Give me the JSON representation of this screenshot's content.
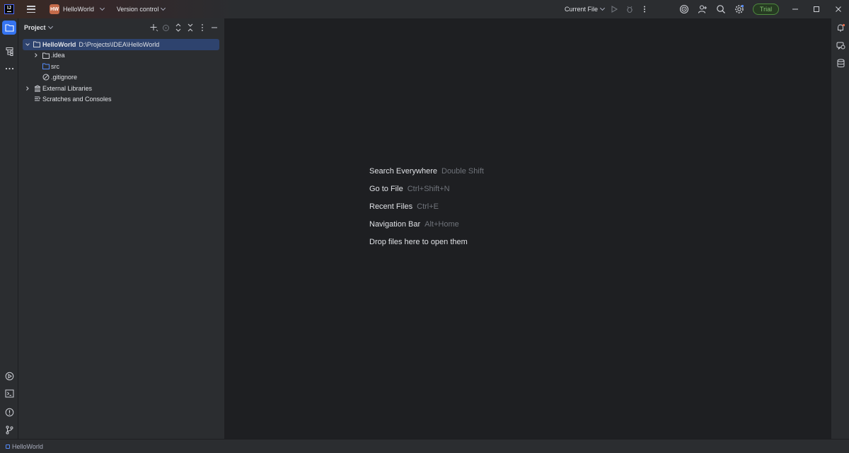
{
  "titlebar": {
    "project_badge": "HW",
    "project_name": "HelloWorld",
    "vcs_label": "Version control",
    "run_config": "Current File",
    "trial_label": "Trial"
  },
  "project_panel": {
    "title": "Project",
    "tree": [
      {
        "label": "HelloWorld",
        "path": "D:\\Projects\\IDEA\\HelloWorld"
      },
      {
        "label": ".idea"
      },
      {
        "label": "src"
      },
      {
        "label": ".gitignore"
      },
      {
        "label": "External Libraries"
      },
      {
        "label": "Scratches and Consoles"
      }
    ]
  },
  "editor": {
    "hints": [
      {
        "label": "Search Everywhere",
        "key": "Double Shift"
      },
      {
        "label": "Go to File",
        "key": "Ctrl+Shift+N"
      },
      {
        "label": "Recent Files",
        "key": "Ctrl+E"
      },
      {
        "label": "Navigation Bar",
        "key": "Alt+Home"
      },
      {
        "label": "Drop files here to open them",
        "key": ""
      }
    ]
  },
  "statusbar": {
    "breadcrumb": "HelloWorld"
  },
  "icons": {
    "left_strip": [
      "project-folder-icon",
      "structure-icon",
      "more-tools-icon",
      "run-icon",
      "terminal-icon",
      "problems-icon",
      "git-icon"
    ],
    "right_strip": [
      "notifications-icon",
      "ai-assistant-icon",
      "database-icon"
    ],
    "titlebar": [
      "app-logo-icon",
      "main-menu-icon",
      "run-icon",
      "debug-icon",
      "more-actions-icon",
      "ai-spiral-icon",
      "add-user-icon",
      "search-icon",
      "settings-icon",
      "minimize-icon",
      "maximize-icon",
      "close-icon"
    ]
  },
  "colors": {
    "accent": "#3574f0",
    "selection": "#2e436e",
    "panel_bg": "#2b2d30",
    "editor_bg": "#1e1f22",
    "trial_green": "#4e8a3e",
    "project_badge": "#c56b4a"
  }
}
